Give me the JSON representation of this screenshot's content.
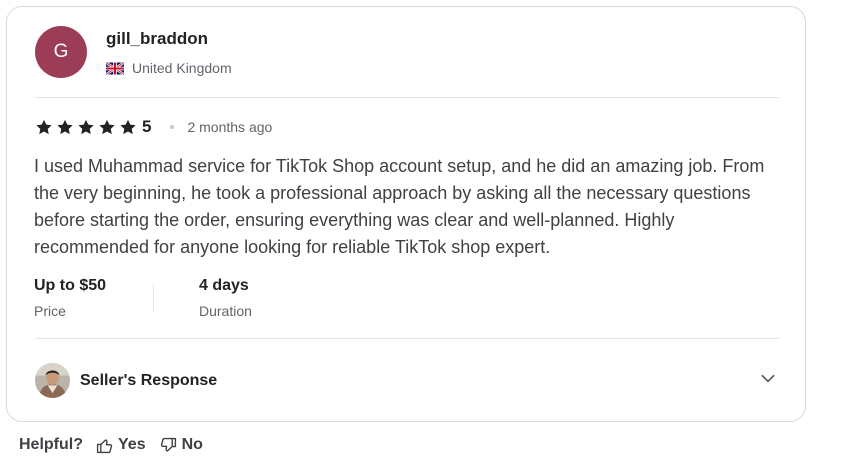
{
  "reviewer": {
    "initial": "G",
    "username": "gill_braddon",
    "country": "United Kingdom",
    "avatar_color": "#9b3d57"
  },
  "rating": {
    "stars": 5,
    "value": "5",
    "time_ago": "2 months ago"
  },
  "review_text": "I used Muhammad service for TikTok Shop account setup, and he did an amazing job. From the very beginning, he took a professional approach by asking all the necessary questions before starting the order, ensuring everything was clear and well-planned. Highly recommended for anyone looking for reliable TikTok shop expert.",
  "order_meta": {
    "price_value": "Up to $50",
    "price_label": "Price",
    "duration_value": "4 days",
    "duration_label": "Duration"
  },
  "seller_response": {
    "label": "Seller's Response"
  },
  "helpful": {
    "question": "Helpful?",
    "yes_label": "Yes",
    "no_label": "No"
  },
  "colors": {
    "star": "#222325",
    "text": "#404145",
    "muted": "#62646a",
    "border": "#dadbdd"
  }
}
